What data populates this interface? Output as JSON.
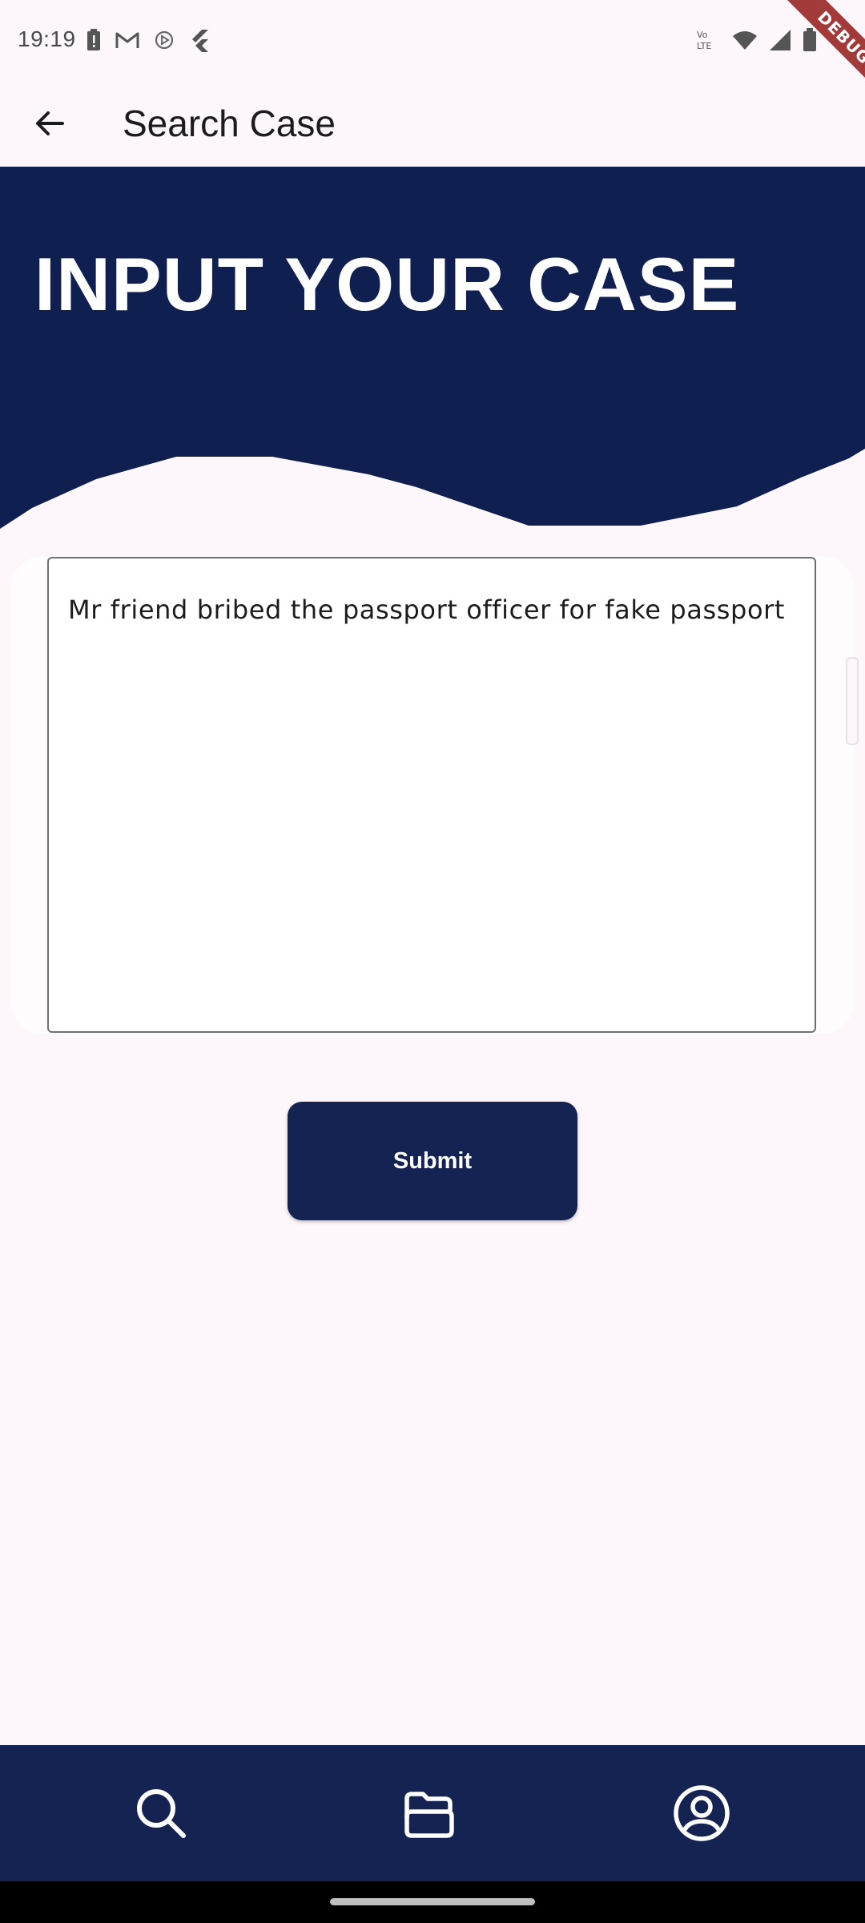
{
  "status_bar": {
    "time": "19:19",
    "left_icons": [
      "battery-alert-icon",
      "gmail-icon",
      "play-games-icon",
      "flutter-icon"
    ],
    "right_icons": [
      "volte-icon",
      "wifi-icon",
      "cell-signal-icon",
      "battery-icon"
    ],
    "volte_top": "Vo",
    "volte_bottom": "LTE"
  },
  "debug_banner": "DEBUG",
  "app_bar": {
    "title": "Search Case",
    "back_icon": "arrow-back-icon"
  },
  "header": {
    "title": "INPUT YOUR CASE",
    "background_color": "#0f1f4f"
  },
  "case_input": {
    "value": "Mr friend bribed the passport officer for fake passport"
  },
  "submit": {
    "label": "Submit",
    "color": "#152353"
  },
  "bottom_nav": {
    "color": "#152353",
    "items": [
      {
        "icon": "search-icon"
      },
      {
        "icon": "folder-icon"
      },
      {
        "icon": "account-circle-icon"
      }
    ]
  }
}
